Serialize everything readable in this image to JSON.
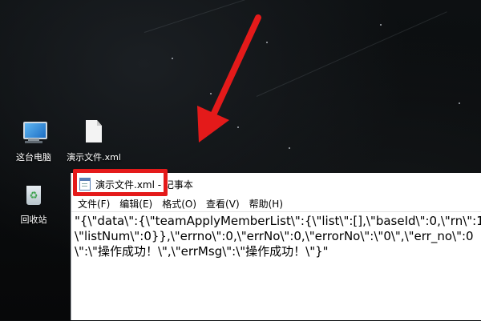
{
  "desktop": {
    "icons": [
      {
        "label": "这台电脑",
        "icon": "computer-icon"
      },
      {
        "label": "演示文件.xml",
        "icon": "file-icon"
      },
      {
        "label": "回收站",
        "icon": "recycle-bin-icon"
      }
    ]
  },
  "notepad": {
    "title": "演示文件.xml - 记事本",
    "menu": [
      "文件(F)",
      "编辑(E)",
      "格式(O)",
      "查看(V)",
      "帮助(H)"
    ],
    "content_line1": "\"{\\\"data\\\":{\\\"teamApplyMemberList\\\":{\\\"list\\\":[],\\\"baseId\\\":0,\\\"rn\\\":1",
    "content_line2": "\\\"listNum\\\":0}},\\\"errno\\\":0,\\\"errNo\\\":0,\\\"errorNo\\\":\\\"0\\\",\\\"err_no\\\":0",
    "content_line3": "\\\":\\\"操作成功！\\\",\\\"errMsg\\\":\\\"操作成功！\\\"}\""
  },
  "annotations": {
    "arrow_color": "#e41a1a",
    "highlight_color": "#e41a1a"
  }
}
